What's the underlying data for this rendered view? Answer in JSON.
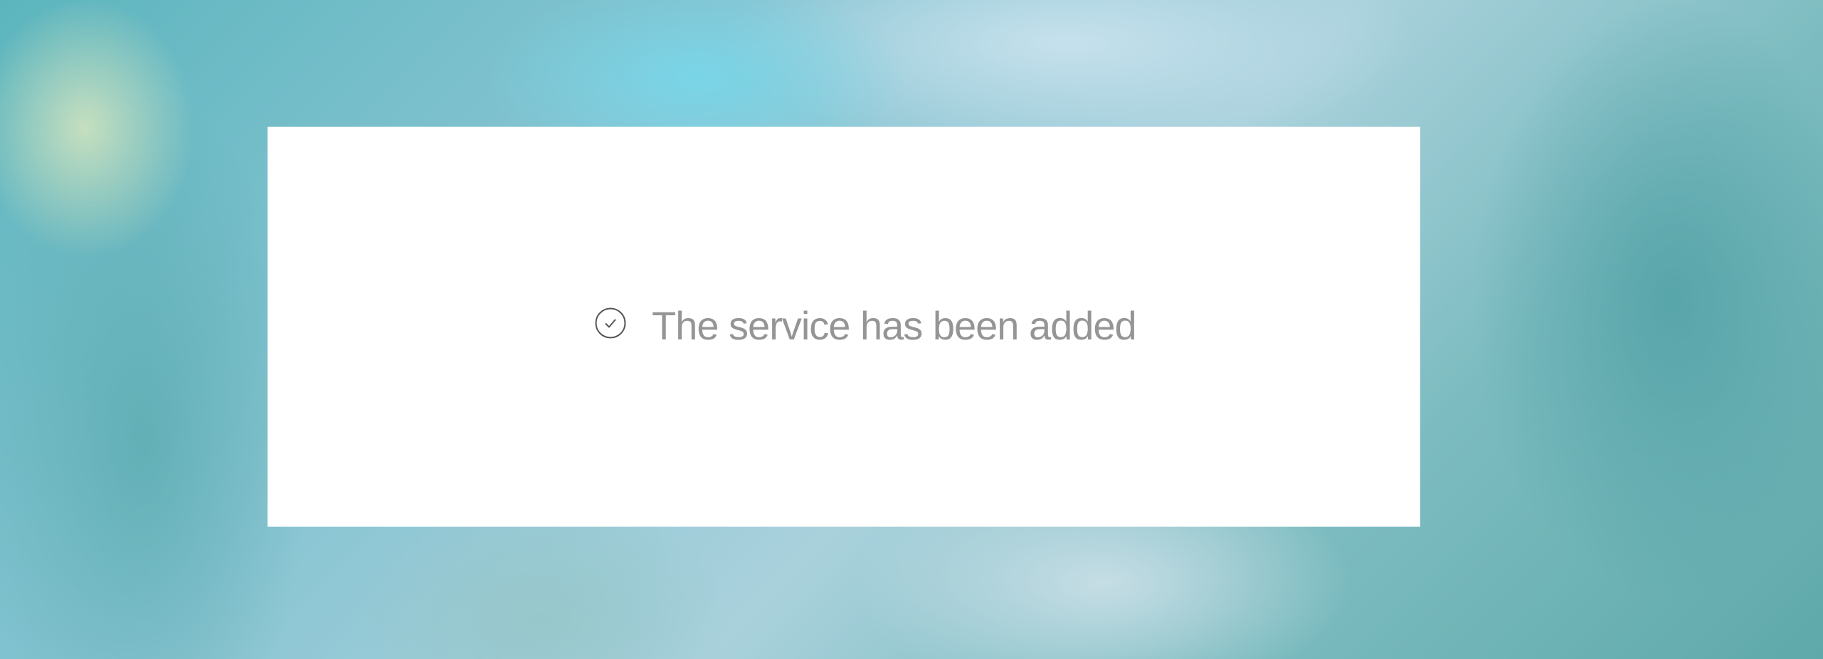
{
  "background": {
    "description_colors": [
      "#5cb5bd",
      "#a9d1dc",
      "#7cbcc0"
    ]
  },
  "dialog": {
    "message": "The service has been added",
    "icon": "check-circle-icon",
    "text_color": "#8a8a8a",
    "icon_color": "#555555"
  }
}
